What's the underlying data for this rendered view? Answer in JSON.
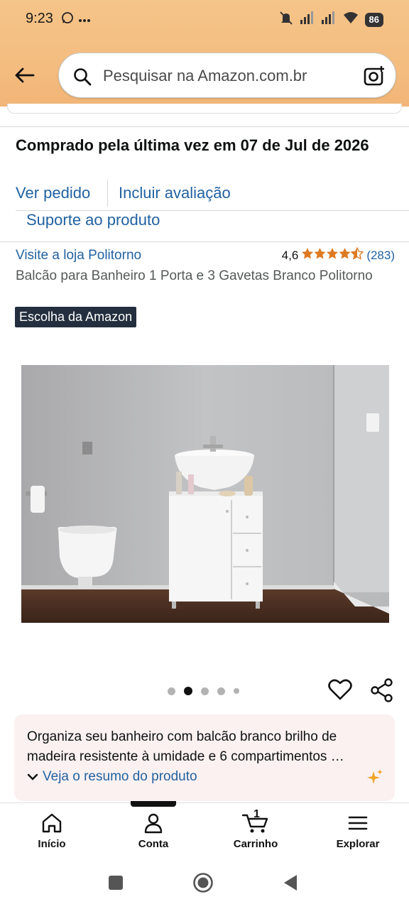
{
  "status_bar": {
    "time": "9:23",
    "battery": "86",
    "icons": [
      "whatsapp-icon",
      "more-dots-icon",
      "mute-icon",
      "signal-icon",
      "signal-icon",
      "wifi-icon",
      "battery-icon"
    ]
  },
  "header": {
    "search_placeholder": "Pesquisar na Amazon.com.br",
    "accent": "#f4bd80"
  },
  "purchase": {
    "last_bought": "Comprado pela última vez em 07 de Jul de 2026",
    "view_order": "Ver pedido",
    "add_review": "Incluir avaliação",
    "product_support": "Suporte ao produto"
  },
  "product": {
    "store": "Visite a loja Politorno",
    "rating_value": "4,6",
    "stars": 4.5,
    "rating_count": "(283)",
    "title": "Balcão para Banheiro 1 Porta e 3 Gavetas Branco Politorno",
    "badge": "Escolha da Amazon",
    "image_count": 5,
    "image_index": 2
  },
  "summary": {
    "text": "Organiza seu banheiro com balcão branco brilho de madeira resistente à umidade e 6 compartimentos …",
    "link": "Veja o resumo do produto"
  },
  "bottom_nav": {
    "items": [
      {
        "label": "Início",
        "icon": "home-icon"
      },
      {
        "label": "Conta",
        "icon": "account-icon"
      },
      {
        "label": "Carrinho",
        "icon": "cart-icon",
        "badge": "1"
      },
      {
        "label": "Explorar",
        "icon": "menu-icon"
      }
    ]
  },
  "colors": {
    "link": "#2162a1",
    "badge_bg": "#232f3e",
    "star": "#de7921",
    "summary_bg": "#fbf1f1"
  }
}
